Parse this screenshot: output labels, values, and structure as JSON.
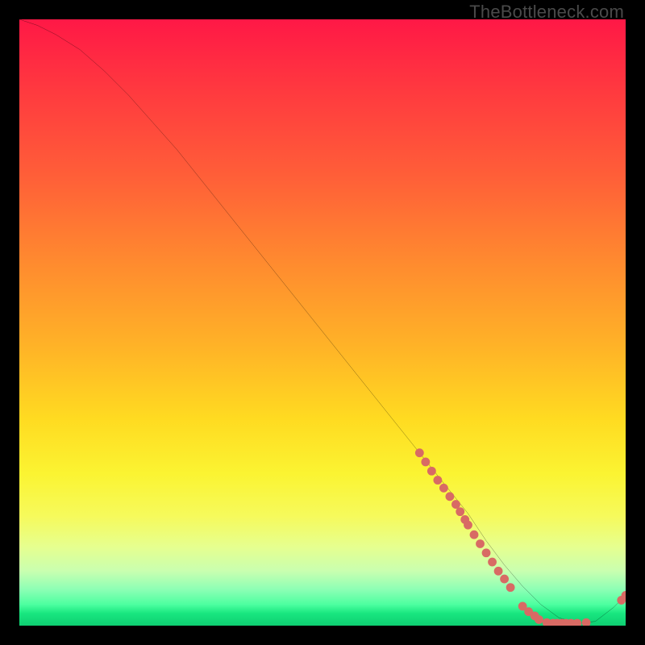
{
  "watermark": "TheBottleneck.com",
  "chart_data": {
    "type": "line",
    "title": "",
    "xlabel": "",
    "ylabel": "",
    "xlim": [
      0,
      100
    ],
    "ylim": [
      0,
      100
    ],
    "series": [
      {
        "name": "bottleneck-curve",
        "x": [
          0,
          3,
          6,
          10,
          14,
          18,
          22,
          26,
          30,
          34,
          38,
          42,
          46,
          50,
          54,
          58,
          62,
          66,
          70,
          74,
          77,
          80,
          83,
          86,
          89,
          92,
          95,
          98,
          100
        ],
        "y": [
          100,
          99,
          97.5,
          95,
          91.5,
          87.5,
          83,
          78.5,
          73.5,
          68.5,
          63.5,
          58.5,
          53.5,
          48.5,
          43.5,
          38.5,
          33.5,
          28.5,
          23.5,
          18.5,
          14,
          10,
          6.5,
          3.5,
          1.3,
          0.4,
          0.7,
          3,
          5
        ]
      }
    ],
    "points": {
      "name": "sample-points",
      "color": "#d86a64",
      "xy": [
        [
          66,
          28.5
        ],
        [
          67,
          27
        ],
        [
          68,
          25.5
        ],
        [
          69,
          24
        ],
        [
          70,
          22.7
        ],
        [
          71,
          21.3
        ],
        [
          72,
          20
        ],
        [
          72.7,
          18.8
        ],
        [
          73.5,
          17.5
        ],
        [
          74,
          16.6
        ],
        [
          75,
          15
        ],
        [
          76,
          13.5
        ],
        [
          77,
          12
        ],
        [
          78,
          10.5
        ],
        [
          79,
          9
        ],
        [
          80,
          7.7
        ],
        [
          81,
          6.3
        ],
        [
          83,
          3.2
        ],
        [
          84,
          2.3
        ],
        [
          85,
          1.6
        ],
        [
          85.7,
          1.0
        ],
        [
          87,
          0.5
        ],
        [
          88,
          0.4
        ],
        [
          88.7,
          0.4
        ],
        [
          89.5,
          0.4
        ],
        [
          90.2,
          0.4
        ],
        [
          91,
          0.4
        ],
        [
          92,
          0.4
        ],
        [
          93.5,
          0.5
        ],
        [
          99.3,
          4.2
        ],
        [
          100,
          5
        ]
      ]
    },
    "background_gradient": {
      "direction": "vertical",
      "stops": [
        {
          "pos": 0.0,
          "color": "#ff1846"
        },
        {
          "pos": 0.26,
          "color": "#ff5f38"
        },
        {
          "pos": 0.54,
          "color": "#ffb327"
        },
        {
          "pos": 0.75,
          "color": "#fbf432"
        },
        {
          "pos": 0.91,
          "color": "#c9ffb0"
        },
        {
          "pos": 1.0,
          "color": "#0ecf72"
        }
      ]
    }
  }
}
